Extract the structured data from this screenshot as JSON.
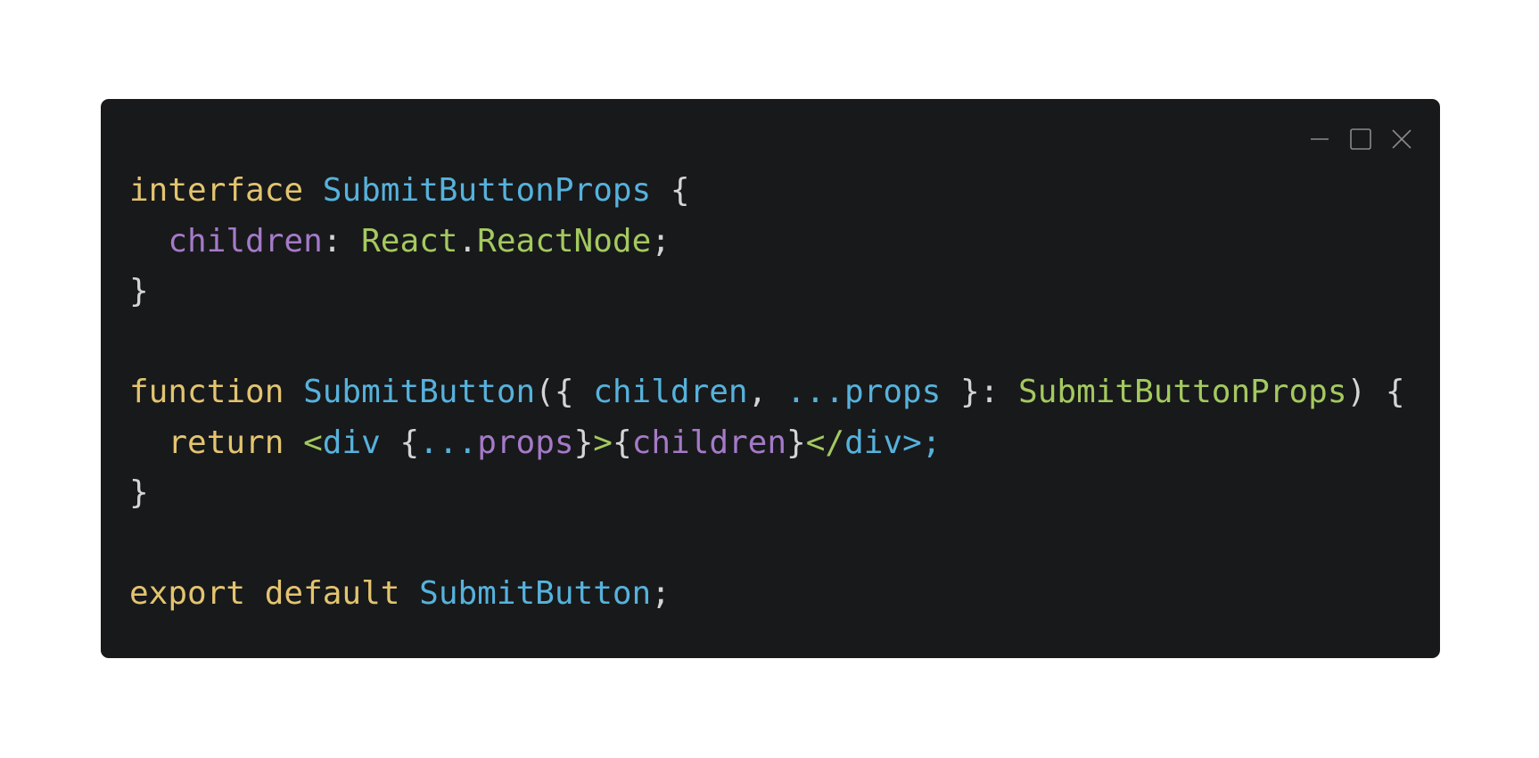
{
  "window": {
    "controls": {
      "minimize_icon": "minimize-icon",
      "maximize_icon": "maximize-icon",
      "close_icon": "close-icon"
    },
    "colors": {
      "background": "#18191b",
      "keyword": "#e3c46f",
      "type": "#56b2dc",
      "property": "#a57ac8",
      "type_ref": "#a4c95f",
      "punctuation": "#d4d4d4"
    }
  },
  "code": {
    "lines": [
      [
        {
          "t": "interface",
          "c": "kw"
        },
        {
          "t": " ",
          "c": "pun"
        },
        {
          "t": "SubmitButtonProps",
          "c": "typ"
        },
        {
          "t": " {",
          "c": "pun"
        }
      ],
      [
        {
          "t": "  ",
          "c": "pun"
        },
        {
          "t": "children",
          "c": "prop"
        },
        {
          "t": ": ",
          "c": "pun"
        },
        {
          "t": "React",
          "c": "grn"
        },
        {
          "t": ".",
          "c": "pun"
        },
        {
          "t": "ReactNode",
          "c": "grn"
        },
        {
          "t": ";",
          "c": "pun"
        }
      ],
      [
        {
          "t": "}",
          "c": "pun"
        }
      ],
      [],
      [
        {
          "t": "function",
          "c": "kw"
        },
        {
          "t": " ",
          "c": "pun"
        },
        {
          "t": "SubmitButton",
          "c": "typ"
        },
        {
          "t": "({ ",
          "c": "pun"
        },
        {
          "t": "children",
          "c": "typ"
        },
        {
          "t": ", ",
          "c": "pun"
        },
        {
          "t": "...props",
          "c": "typ"
        },
        {
          "t": " }: ",
          "c": "pun"
        },
        {
          "t": "SubmitButtonProps",
          "c": "grn"
        },
        {
          "t": ") {",
          "c": "pun"
        }
      ],
      [
        {
          "t": "  ",
          "c": "pun"
        },
        {
          "t": "return",
          "c": "kw"
        },
        {
          "t": " ",
          "c": "pun"
        },
        {
          "t": "<",
          "c": "grn"
        },
        {
          "t": "div",
          "c": "typ"
        },
        {
          "t": " {",
          "c": "pun"
        },
        {
          "t": "...",
          "c": "typ"
        },
        {
          "t": "props",
          "c": "prop"
        },
        {
          "t": "}",
          "c": "pun"
        },
        {
          "t": ">",
          "c": "grn"
        },
        {
          "t": "{",
          "c": "pun"
        },
        {
          "t": "children",
          "c": "prop"
        },
        {
          "t": "}",
          "c": "pun"
        },
        {
          "t": "</",
          "c": "grn"
        },
        {
          "t": "div",
          "c": "typ"
        },
        {
          "t": ">;",
          "c": "typ"
        }
      ],
      [
        {
          "t": "}",
          "c": "pun"
        }
      ],
      [],
      [
        {
          "t": "export",
          "c": "kw"
        },
        {
          "t": " ",
          "c": "pun"
        },
        {
          "t": "default",
          "c": "kw"
        },
        {
          "t": " ",
          "c": "pun"
        },
        {
          "t": "SubmitButton",
          "c": "typ"
        },
        {
          "t": ";",
          "c": "pun"
        }
      ]
    ]
  }
}
